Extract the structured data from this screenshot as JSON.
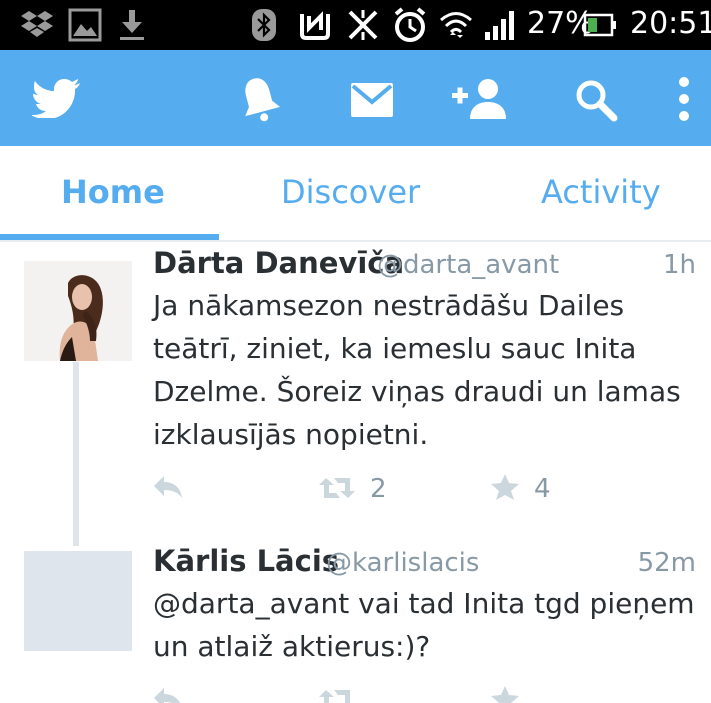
{
  "status_bar": {
    "icons": [
      "dropbox-icon",
      "gallery-icon",
      "download-icon",
      "bluetooth-icon",
      "nfc-icon",
      "vibrate-off-icon",
      "alarm-icon",
      "wifi-icon",
      "signal-icon",
      "battery-icon"
    ],
    "battery_percent": "27%",
    "time": "20:51"
  },
  "app_bar": {
    "color": "#55acee",
    "icons": [
      "twitter-bird-icon",
      "notifications-bell-icon",
      "messages-envelope-icon",
      "add-user-icon",
      "search-icon",
      "overflow-menu-icon"
    ]
  },
  "tabs": [
    {
      "label": "Home",
      "active": true
    },
    {
      "label": "Discover",
      "active": false
    },
    {
      "label": "Activity",
      "active": false
    }
  ],
  "tweets": [
    {
      "name": "Dārta Danevīča",
      "handle": "@darta_avant",
      "time": "1h",
      "lines": [
        "Ja nākamsezon nestrādāšu Dailes",
        "teātrī, ziniet, ka iemeslu sauc Inita",
        "Dzelme. Šoreiz viņas draudi un lamas",
        "izklausījās nopietni."
      ],
      "retweets": "2",
      "favorites": "4"
    },
    {
      "name": "Kārlis Lācis",
      "handle": "@karlislacis",
      "time": "52m",
      "lines": [
        "@darta_avant vai tad Inita tgd pieņem",
        "un atlaiž aktierus:)?"
      ],
      "retweets": "",
      "favorites": ""
    }
  ]
}
